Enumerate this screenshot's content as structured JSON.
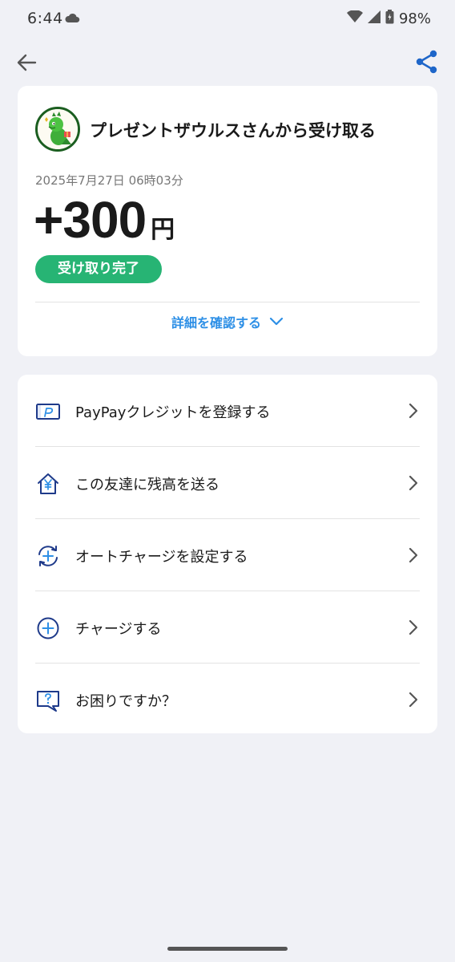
{
  "status_bar": {
    "time": "6:44",
    "battery": "98%"
  },
  "summary": {
    "sender_title": "プレゼントザウルスさんから受け取る",
    "datetime": "2025年7月27日 06時03分",
    "amount": "+300",
    "amount_unit": "円",
    "status": "受け取り完了",
    "details_link": "詳細を確認する"
  },
  "menu": {
    "items": [
      {
        "label": "PayPayクレジットを登録する",
        "icon": "credit-card-icon"
      },
      {
        "label": "この友達に残高を送る",
        "icon": "yen-house-icon"
      },
      {
        "label": "オートチャージを設定する",
        "icon": "auto-charge-icon"
      },
      {
        "label": "チャージする",
        "icon": "plus-circle-icon"
      },
      {
        "label": "お困りですか？",
        "icon": "help-chat-icon"
      }
    ]
  },
  "colors": {
    "background": "#f0f1f6",
    "accent_blue": "#2d8fe6",
    "icon_navy": "#1e3a8a",
    "status_green": "#27b474"
  }
}
